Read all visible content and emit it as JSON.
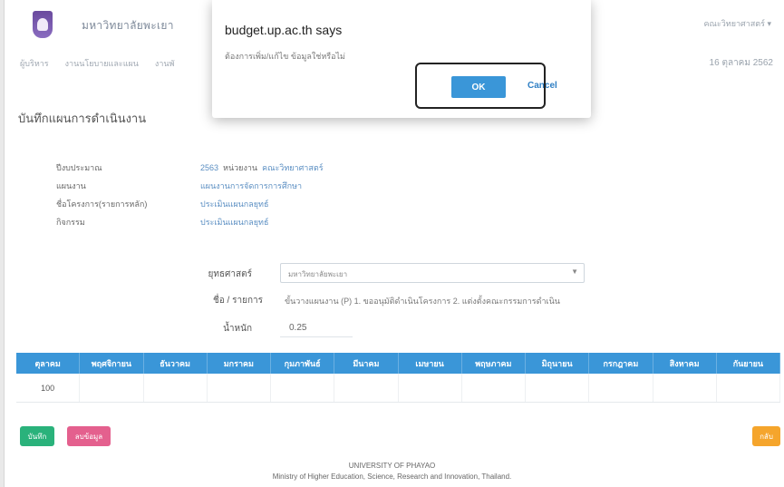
{
  "header": {
    "university_name": "มหาวิทยาลัยพะเยา",
    "user_menu": "คณะวิทยาศาสตร์ ▾",
    "date": "16 ตุลาคม 2562"
  },
  "nav": {
    "items": [
      "ผู้บริหาร",
      "งานนโยบายและแผน",
      "งานพั"
    ]
  },
  "page": {
    "title": "บันทึกแผนการดำเนินงาน"
  },
  "info": {
    "budget_year_label": "ปีงบประมาณ",
    "budget_year_value": "2563",
    "unit_label": "หน่วยงาน",
    "unit_value": "คณะวิทยาศาสตร์",
    "plan_label": "แผนงาน",
    "plan_value": "แผนงานการจัดการการศึกษา",
    "project_label": "ชื่อโครงการ(รายการหลัก)",
    "project_value": "ประเมินแผนกลยุทธ์",
    "activity_label": "กิจกรรม",
    "activity_value": "ประเมินแผนกลยุทธ์"
  },
  "form": {
    "strategy_label": "ยุทธศาสตร์",
    "strategy_value": "มหาวิทยาลัยพะเยา",
    "item_label": "ชื่อ / รายการ",
    "item_value": "ขั้นวางแผนงาน (P) 1. ขออนุมัติดำเนินโครงการ 2. แต่งตั้งคณะกรรมการดำเนิน",
    "weight_label": "น้ำหนัก",
    "weight_value": "0.25"
  },
  "months": {
    "headers": [
      "ตุลาคม",
      "พฤศจิกายน",
      "ธันวาคม",
      "มกราคม",
      "กุมภาพันธ์",
      "มีนาคม",
      "เมษายน",
      "พฤษภาคม",
      "มิถุนายน",
      "กรกฎาคม",
      "สิงหาคม",
      "กันยายน"
    ],
    "values": [
      "100",
      "",
      "",
      "",
      "",
      "",
      "",
      "",
      "",
      "",
      "",
      ""
    ]
  },
  "buttons": {
    "save": "บันทึก",
    "delete": "ลบข้อมูล",
    "back": "กลับ"
  },
  "footer": {
    "line1": "UNIVERSITY OF PHAYAO",
    "line2": "Ministry of Higher Education, Science, Research and Innovation, Thailand."
  },
  "dialog": {
    "title": "budget.up.ac.th says",
    "message": "ต้องการเพิ่ม/แก้ไข ข้อมูลใช่หรือไม่",
    "ok_label": "OK",
    "cancel_label": "Cancel"
  }
}
